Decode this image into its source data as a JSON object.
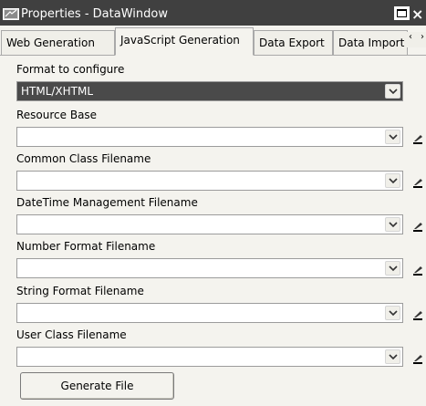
{
  "window": {
    "title": "Properties - DataWindow",
    "maximize_icon": "maximize-icon",
    "close_glyph": "×"
  },
  "tabs": [
    {
      "label": "Web Generation",
      "active": false
    },
    {
      "label": "JavaScript Generation",
      "active": true
    },
    {
      "label": "Data Export",
      "active": false
    },
    {
      "label": "Data Import",
      "active": false
    }
  ],
  "tab_scroll": {
    "left": "‹",
    "right": "›"
  },
  "form": {
    "format": {
      "label": "Format to configure",
      "value": "HTML/XHTML"
    },
    "fields": [
      {
        "label": "Resource Base",
        "value": ""
      },
      {
        "label": "Common Class Filename",
        "value": ""
      },
      {
        "label": "DateTime Management Filename",
        "value": ""
      },
      {
        "label": "Number Format Filename",
        "value": ""
      },
      {
        "label": "String Format Filename",
        "value": ""
      },
      {
        "label": "User Class Filename",
        "value": ""
      }
    ]
  },
  "generate_button": {
    "label": "Generate File"
  },
  "colors": {
    "titlebar": "#404040",
    "selected_combo": "#4a4a4a",
    "panel": "#f4f3ee"
  }
}
